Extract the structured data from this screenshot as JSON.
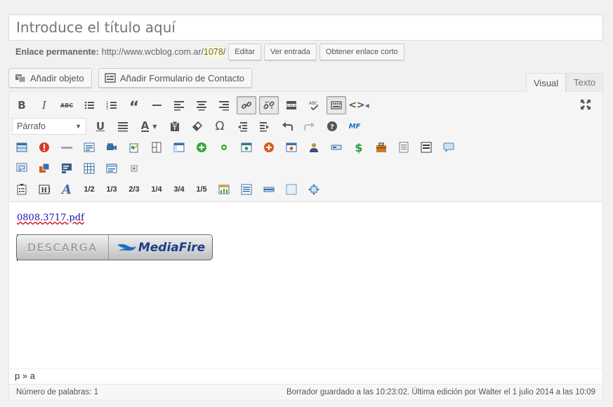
{
  "title": {
    "placeholder": "Introduce el título aquí"
  },
  "permalink": {
    "label": "Enlace permanente:",
    "base": "http://www.wcblog.com.ar/",
    "slug": "1078",
    "suffix": "/",
    "edit_label": "Editar",
    "view_label": "Ver entrada",
    "shortlink_label": "Obtener enlace corto"
  },
  "media": {
    "add_object": "Añadir objeto",
    "add_form": "Añadir Formulario de Contacto"
  },
  "tabs": {
    "visual": "Visual",
    "text": "Texto"
  },
  "toolbar": {
    "format_select": "Párrafo",
    "fractions": [
      "1/2",
      "1/3",
      "2/3",
      "1/4",
      "3/4",
      "1/5"
    ],
    "mf_label": "MF"
  },
  "content": {
    "file_link": "0808.3717.pdf",
    "download_left": "DESCARGA",
    "download_brand": "MediaFire"
  },
  "path": "p » a",
  "status": {
    "word_count": "Número de palabras: 1",
    "draft_saved": "Borrador guardado a las 10:23:02. Última edición por Walter el 1 julio 2014 a las 10:09"
  }
}
